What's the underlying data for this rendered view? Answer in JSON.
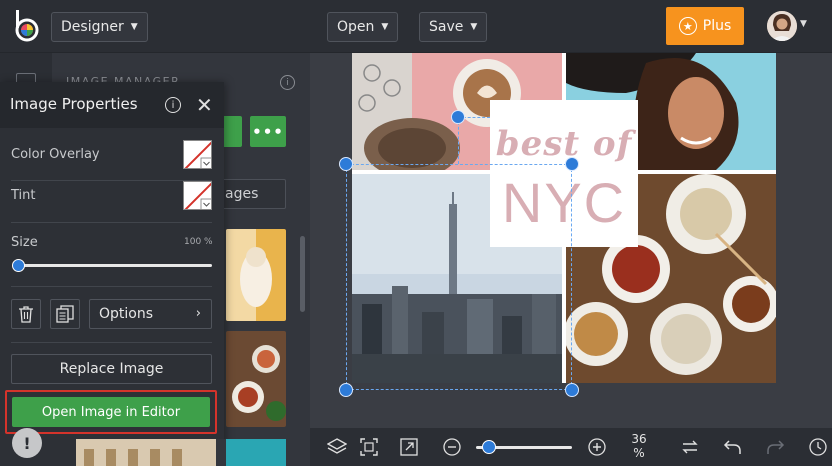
{
  "topbar": {
    "mode_label": "Designer",
    "open_label": "Open",
    "save_label": "Save",
    "plus_label": "Plus"
  },
  "manager": {
    "title": "IMAGE MANAGER",
    "more_label": "•••",
    "tab_label": "ages"
  },
  "props": {
    "title": "Image Properties",
    "color_overlay_label": "Color Overlay",
    "tint_label": "Tint",
    "size_label": "Size",
    "size_value": "100 %",
    "size_fraction": 0.02,
    "options_label": "Options",
    "replace_label": "Replace Image",
    "open_editor_label": "Open Image in Editor"
  },
  "canvas": {
    "line1": "best of",
    "line2": "NYC"
  },
  "bottom": {
    "zoom_value": "36",
    "zoom_unit": "%",
    "zoom_fraction": 0.08
  },
  "colors": {
    "accent_orange": "#f7931e",
    "accent_green": "#3ea04a",
    "selection_blue": "#2d7bd8",
    "highlight_red": "#d4332b",
    "title_pink": "#d8aeb4"
  }
}
